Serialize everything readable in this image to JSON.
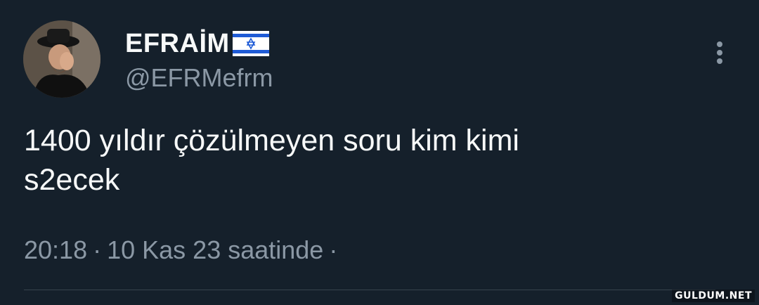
{
  "author": {
    "display_name": "EFRAİM",
    "flag_emoji": "israel-flag",
    "handle": "@EFRMefrm"
  },
  "tweet": {
    "text": "1400 yıldır çözülmeyen soru kim kimi\ns2ecek"
  },
  "meta": {
    "time": "20:18",
    "date": "10 Kas 23 saatinde",
    "separator": "·"
  },
  "watermark": "GULDUM.NET",
  "colors": {
    "background": "#15202b",
    "primary_text": "#f7f9f9",
    "secondary_text": "#8b98a5",
    "divider": "#38444d"
  }
}
